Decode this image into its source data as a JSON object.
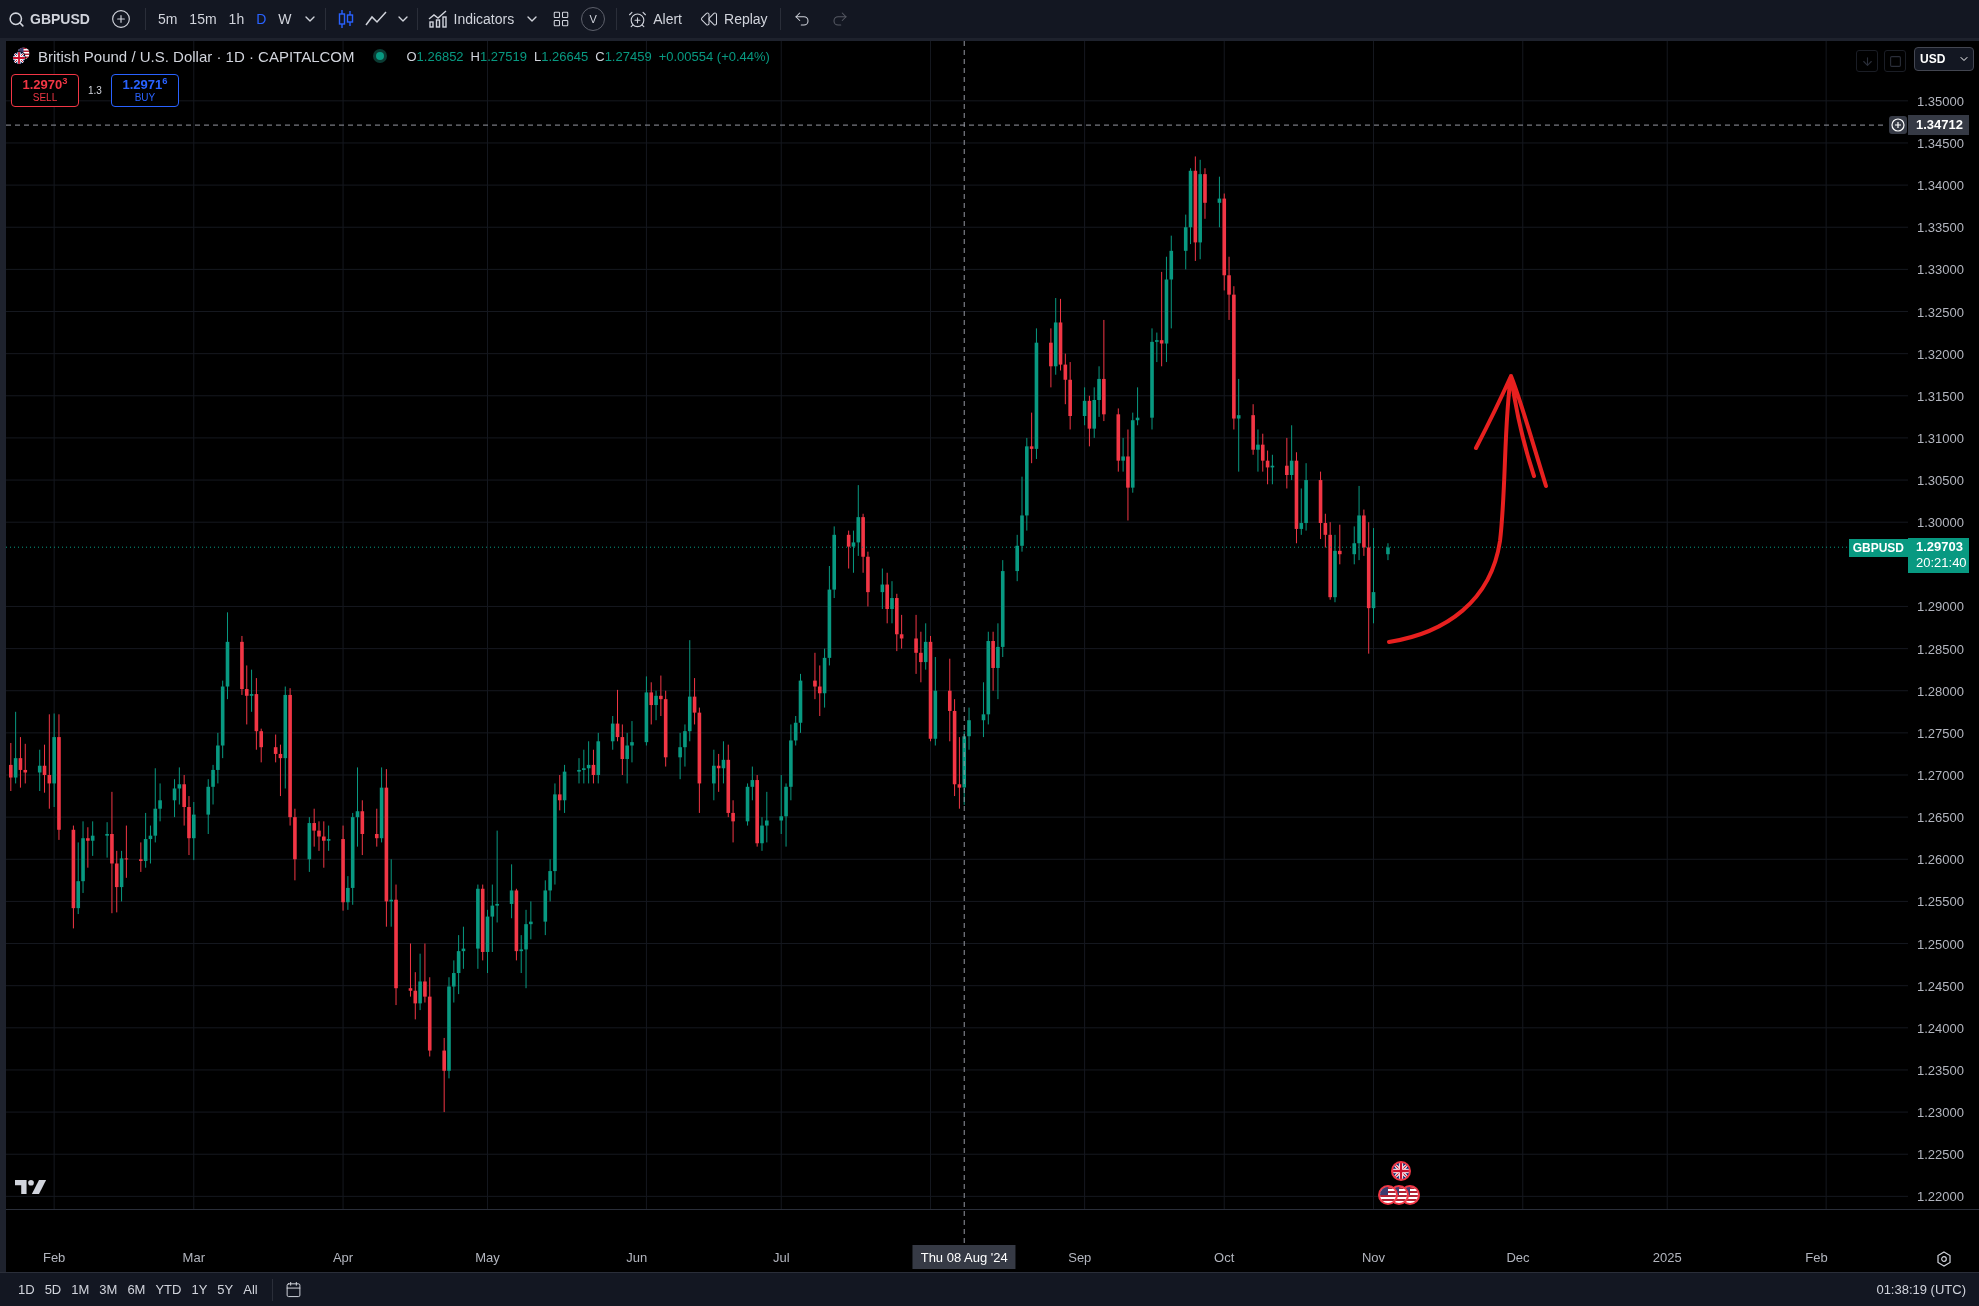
{
  "toolbar": {
    "symbol": "GBPUSD",
    "intervals": [
      {
        "label": "5m",
        "selected": false
      },
      {
        "label": "15m",
        "selected": false
      },
      {
        "label": "1h",
        "selected": false
      },
      {
        "label": "D",
        "selected": true
      },
      {
        "label": "W",
        "selected": false
      }
    ],
    "chart_styles": [
      {
        "kind": "candles",
        "selected": true
      },
      {
        "kind": "line",
        "selected": false
      }
    ],
    "indicators": "Indicators",
    "v_button": "V",
    "alert": "Alert",
    "replay": "Replay",
    "undo_disabled": false,
    "redo_disabled": true
  },
  "legend": {
    "title": "British Pound / U.S. Dollar · 1D · CAPITALCOM",
    "market_open": true,
    "change_up": true,
    "readings": [
      {
        "key": "O",
        "value": "1.26852"
      },
      {
        "key": "H",
        "value": "1.27519"
      },
      {
        "key": "L",
        "value": "1.26645"
      },
      {
        "key": "C",
        "value": "1.27459"
      }
    ],
    "change": "+0.00554 (+0.44%)"
  },
  "trade": {
    "sell_price": "1.2970$^{3}$",
    "sell_label": "SELL",
    "spread": "1.3",
    "buy_price": "1.2971$^{6}$",
    "buy_label": "BUY"
  },
  "price_scale": {
    "currency": "USD"
  },
  "price_tag": {
    "symbol": "GBPUSD",
    "countdown": "20:21:40"
  },
  "chart": {
    "chart_data": {
      "type": "candlestick",
      "grid": true,
      "xlim": [
        "2024-01-22",
        "2025-02-20"
      ],
      "ylim": [
        1.2185,
        1.3571
      ],
      "x": [
        "2024-01-23",
        "2024-01-24",
        "2024-01-25",
        "2024-01-26",
        "2024-01-29",
        "2024-01-30",
        "2024-01-31",
        "2024-02-01",
        "2024-02-02",
        "2024-02-05",
        "2024-02-06",
        "2024-02-07",
        "2024-02-08",
        "2024-02-09",
        "2024-02-12",
        "2024-02-13",
        "2024-02-14",
        "2024-02-15",
        "2024-02-16",
        "2024-02-19",
        "2024-02-20",
        "2024-02-21",
        "2024-02-22",
        "2024-02-23",
        "2024-02-26",
        "2024-02-27",
        "2024-02-28",
        "2024-02-29",
        "2024-03-01",
        "2024-03-04",
        "2024-03-05",
        "2024-03-06",
        "2024-03-07",
        "2024-03-08",
        "2024-03-11",
        "2024-03-12",
        "2024-03-13",
        "2024-03-14",
        "2024-03-15",
        "2024-03-18",
        "2024-03-19",
        "2024-03-20",
        "2024-03-21",
        "2024-03-22",
        "2024-03-25",
        "2024-03-26",
        "2024-03-27",
        "2024-03-28",
        "2024-03-29",
        "2024-04-01",
        "2024-04-02",
        "2024-04-03",
        "2024-04-04",
        "2024-04-05",
        "2024-04-08",
        "2024-04-09",
        "2024-04-10",
        "2024-04-11",
        "2024-04-12",
        "2024-04-15",
        "2024-04-16",
        "2024-04-17",
        "2024-04-18",
        "2024-04-19",
        "2024-04-22",
        "2024-04-23",
        "2024-04-24",
        "2024-04-25",
        "2024-04-26",
        "2024-04-29",
        "2024-04-30",
        "2024-05-01",
        "2024-05-02",
        "2024-05-03",
        "2024-05-06",
        "2024-05-07",
        "2024-05-08",
        "2024-05-09",
        "2024-05-10",
        "2024-05-13",
        "2024-05-14",
        "2024-05-15",
        "2024-05-16",
        "2024-05-17",
        "2024-05-20",
        "2024-05-21",
        "2024-05-22",
        "2024-05-23",
        "2024-05-24",
        "2024-05-27",
        "2024-05-28",
        "2024-05-29",
        "2024-05-30",
        "2024-05-31",
        "2024-06-03",
        "2024-06-04",
        "2024-06-05",
        "2024-06-06",
        "2024-06-07",
        "2024-06-10",
        "2024-06-11",
        "2024-06-12",
        "2024-06-13",
        "2024-06-14",
        "2024-06-17",
        "2024-06-18",
        "2024-06-19",
        "2024-06-20",
        "2024-06-21",
        "2024-06-24",
        "2024-06-25",
        "2024-06-26",
        "2024-06-27",
        "2024-06-28",
        "2024-07-01",
        "2024-07-02",
        "2024-07-03",
        "2024-07-04",
        "2024-07-05",
        "2024-07-08",
        "2024-07-09",
        "2024-07-10",
        "2024-07-11",
        "2024-07-12",
        "2024-07-15",
        "2024-07-16",
        "2024-07-17",
        "2024-07-18",
        "2024-07-19",
        "2024-07-22",
        "2024-07-23",
        "2024-07-24",
        "2024-07-25",
        "2024-07-26",
        "2024-07-29",
        "2024-07-30",
        "2024-07-31",
        "2024-08-01",
        "2024-08-02",
        "2024-08-05",
        "2024-08-06",
        "2024-08-07",
        "2024-08-08",
        "2024-08-09",
        "2024-08-12",
        "2024-08-13",
        "2024-08-14",
        "2024-08-15",
        "2024-08-16",
        "2024-08-19",
        "2024-08-20",
        "2024-08-21",
        "2024-08-22",
        "2024-08-23",
        "2024-08-26",
        "2024-08-27",
        "2024-08-28",
        "2024-08-29",
        "2024-08-30",
        "2024-09-02",
        "2024-09-03",
        "2024-09-04",
        "2024-09-05",
        "2024-09-06",
        "2024-09-09",
        "2024-09-10",
        "2024-09-11",
        "2024-09-12",
        "2024-09-13",
        "2024-09-16",
        "2024-09-17",
        "2024-09-18",
        "2024-09-19",
        "2024-09-20",
        "2024-09-23",
        "2024-09-24",
        "2024-09-25",
        "2024-09-26",
        "2024-09-27",
        "2024-09-30",
        "2024-10-01",
        "2024-10-02",
        "2024-10-03",
        "2024-10-04",
        "2024-10-07",
        "2024-10-08",
        "2024-10-09",
        "2024-10-10",
        "2024-10-11",
        "2024-10-14",
        "2024-10-15",
        "2024-10-16",
        "2024-10-17",
        "2024-10-18",
        "2024-10-21",
        "2024-10-22",
        "2024-10-23",
        "2024-10-24",
        "2024-10-25",
        "2024-10-28",
        "2024-10-29",
        "2024-10-30",
        "2024-10-31",
        "2024-11-01",
        "2024-11-04"
      ],
      "ohlc": [
        [
          1.2712,
          1.2738,
          1.2681,
          1.2697
        ],
        [
          1.2697,
          1.2775,
          1.269,
          1.272
        ],
        [
          1.272,
          1.2745,
          1.2685,
          1.2706
        ],
        [
          1.2706,
          1.2737,
          1.269,
          1.2703
        ],
        [
          1.2703,
          1.273,
          1.2681,
          1.2711
        ],
        [
          1.2711,
          1.2736,
          1.2679,
          1.27
        ],
        [
          1.27,
          1.2772,
          1.266,
          1.269
        ],
        [
          1.269,
          1.2773,
          1.2662,
          1.2745
        ],
        [
          1.2745,
          1.2772,
          1.2623,
          1.2635
        ],
        [
          1.2635,
          1.264,
          1.2518,
          1.2542
        ],
        [
          1.2542,
          1.262,
          1.2535,
          1.2574
        ],
        [
          1.2574,
          1.2645,
          1.256,
          1.2625
        ],
        [
          1.2625,
          1.2638,
          1.259,
          1.2622
        ],
        [
          1.2622,
          1.2645,
          1.2604,
          1.2628
        ],
        [
          1.2628,
          1.2644,
          1.2602,
          1.263
        ],
        [
          1.263,
          1.268,
          1.2536,
          1.2595
        ],
        [
          1.2595,
          1.261,
          1.2537,
          1.2567
        ],
        [
          1.2567,
          1.261,
          1.255,
          1.2601
        ],
        [
          1.2601,
          1.264,
          1.2578,
          1.26
        ],
        [
          1.26,
          1.262,
          1.2585,
          1.2598
        ],
        [
          1.2598,
          1.2655,
          1.259,
          1.2624
        ],
        [
          1.2624,
          1.264,
          1.2595,
          1.2628
        ],
        [
          1.2628,
          1.2708,
          1.262,
          1.266
        ],
        [
          1.266,
          1.269,
          1.2645,
          1.267
        ],
        [
          1.267,
          1.2695,
          1.265,
          1.2684
        ],
        [
          1.2684,
          1.2709,
          1.2665,
          1.2689
        ],
        [
          1.2689,
          1.27,
          1.264,
          1.2662
        ],
        [
          1.2662,
          1.2675,
          1.2605,
          1.2625
        ],
        [
          1.2625,
          1.2668,
          1.2599,
          1.2653
        ],
        [
          1.2653,
          1.2695,
          1.263,
          1.2686
        ],
        [
          1.2686,
          1.2712,
          1.2665,
          1.2706
        ],
        [
          1.2706,
          1.275,
          1.269,
          1.2735
        ],
        [
          1.2735,
          1.2812,
          1.272,
          1.2805
        ],
        [
          1.2805,
          1.2893,
          1.279,
          1.2858
        ],
        [
          1.2858,
          1.2865,
          1.2795,
          1.2802
        ],
        [
          1.2802,
          1.283,
          1.276,
          1.2794
        ],
        [
          1.2794,
          1.2825,
          1.2775,
          1.2796
        ],
        [
          1.2796,
          1.2815,
          1.273,
          1.2752
        ],
        [
          1.2752,
          1.2755,
          1.2715,
          1.2733
        ],
        [
          1.2733,
          1.2748,
          1.2715,
          1.2725
        ],
        [
          1.2725,
          1.2736,
          1.2675,
          1.272
        ],
        [
          1.272,
          1.2805,
          1.2684,
          1.2795
        ],
        [
          1.2795,
          1.2803,
          1.264,
          1.265
        ],
        [
          1.265,
          1.266,
          1.2575,
          1.26
        ],
        [
          1.26,
          1.265,
          1.2585,
          1.2643
        ],
        [
          1.2643,
          1.266,
          1.2615,
          1.2634
        ],
        [
          1.2634,
          1.2645,
          1.261,
          1.2627
        ],
        [
          1.2627,
          1.2645,
          1.259,
          1.2622
        ],
        [
          1.2622,
          1.264,
          1.261,
          1.2624
        ],
        [
          1.2624,
          1.264,
          1.2539,
          1.2549
        ],
        [
          1.2549,
          1.258,
          1.254,
          1.2566
        ],
        [
          1.2566,
          1.2655,
          1.2546,
          1.265
        ],
        [
          1.265,
          1.2709,
          1.2615,
          1.2657
        ],
        [
          1.2657,
          1.267,
          1.2605,
          1.263
        ],
        [
          1.263,
          1.266,
          1.2615,
          1.2625
        ],
        [
          1.2625,
          1.2709,
          1.262,
          1.2685
        ],
        [
          1.2685,
          1.2707,
          1.252,
          1.255
        ],
        [
          1.255,
          1.26,
          1.252,
          1.2552
        ],
        [
          1.2552,
          1.257,
          1.2427,
          1.2447
        ],
        [
          1.2447,
          1.25,
          1.2437,
          1.2444
        ],
        [
          1.2444,
          1.2466,
          1.241,
          1.2429
        ],
        [
          1.2429,
          1.2488,
          1.2421,
          1.2455
        ],
        [
          1.2455,
          1.25,
          1.243,
          1.2437
        ],
        [
          1.2437,
          1.246,
          1.2366,
          1.2373
        ],
        [
          1.2373,
          1.2388,
          1.23,
          1.2349
        ],
        [
          1.2349,
          1.246,
          1.234,
          1.2449
        ],
        [
          1.2449,
          1.248,
          1.243,
          1.2465
        ],
        [
          1.2465,
          1.251,
          1.244,
          1.2491
        ],
        [
          1.2491,
          1.252,
          1.247,
          1.2494
        ],
        [
          1.2494,
          1.257,
          1.247,
          1.2565
        ],
        [
          1.2565,
          1.257,
          1.248,
          1.249
        ],
        [
          1.249,
          1.254,
          1.2465,
          1.2532
        ],
        [
          1.2532,
          1.257,
          1.249,
          1.2545
        ],
        [
          1.2545,
          1.2634,
          1.2525,
          1.2547
        ],
        [
          1.2547,
          1.2594,
          1.253,
          1.2563
        ],
        [
          1.2563,
          1.2565,
          1.248,
          1.2491
        ],
        [
          1.2491,
          1.251,
          1.2465,
          1.2493
        ],
        [
          1.2493,
          1.254,
          1.2447,
          1.2523
        ],
        [
          1.2523,
          1.255,
          1.2505,
          1.2526
        ],
        [
          1.2526,
          1.2575,
          1.251,
          1.2563
        ],
        [
          1.2563,
          1.26,
          1.255,
          1.2586
        ],
        [
          1.2586,
          1.269,
          1.257,
          1.2677
        ],
        [
          1.2677,
          1.27,
          1.2658,
          1.267
        ],
        [
          1.267,
          1.2712,
          1.2655,
          1.2704
        ],
        [
          1.2704,
          1.272,
          1.269,
          1.2706
        ],
        [
          1.2706,
          1.273,
          1.269,
          1.2708
        ],
        [
          1.2708,
          1.274,
          1.269,
          1.2712
        ],
        [
          1.2712,
          1.273,
          1.269,
          1.27
        ],
        [
          1.27,
          1.275,
          1.269,
          1.274
        ],
        [
          1.274,
          1.277,
          1.273,
          1.2761
        ],
        [
          1.2761,
          1.2801,
          1.274,
          1.2745
        ],
        [
          1.2745,
          1.276,
          1.27,
          1.2719
        ],
        [
          1.2719,
          1.275,
          1.269,
          1.2735
        ],
        [
          1.2735,
          1.2764,
          1.2715,
          1.2739
        ],
        [
          1.2739,
          1.2817,
          1.2735,
          1.2798
        ],
        [
          1.2798,
          1.281,
          1.276,
          1.2783
        ],
        [
          1.2783,
          1.28,
          1.2765,
          1.2794
        ],
        [
          1.2794,
          1.2818,
          1.277,
          1.279
        ],
        [
          1.279,
          1.28,
          1.271,
          1.2721
        ],
        [
          1.2721,
          1.275,
          1.2695,
          1.2733
        ],
        [
          1.2733,
          1.276,
          1.271,
          1.2752
        ],
        [
          1.2752,
          1.286,
          1.274,
          1.2793
        ],
        [
          1.2793,
          1.2815,
          1.276,
          1.2774
        ],
        [
          1.2774,
          1.278,
          1.2655,
          1.269
        ],
        [
          1.269,
          1.273,
          1.267,
          1.2711
        ],
        [
          1.2711,
          1.2725,
          1.268,
          1.2708
        ],
        [
          1.2708,
          1.274,
          1.269,
          1.2718
        ],
        [
          1.2718,
          1.2736,
          1.265,
          1.2655
        ],
        [
          1.2655,
          1.267,
          1.262,
          1.2645
        ],
        [
          1.2645,
          1.269,
          1.264,
          1.2686
        ],
        [
          1.2686,
          1.271,
          1.267,
          1.2694
        ],
        [
          1.2694,
          1.27,
          1.2615,
          1.2619
        ],
        [
          1.2619,
          1.265,
          1.261,
          1.264
        ],
        [
          1.264,
          1.268,
          1.262,
          1.2646
        ],
        [
          1.2646,
          1.27,
          1.263,
          1.2651
        ],
        [
          1.2651,
          1.269,
          1.2615,
          1.2686
        ],
        [
          1.2686,
          1.276,
          1.267,
          1.2741
        ],
        [
          1.2741,
          1.277,
          1.2735,
          1.2762
        ],
        [
          1.2762,
          1.282,
          1.275,
          1.2812
        ],
        [
          1.2812,
          1.2845,
          1.279,
          1.2805
        ],
        [
          1.2805,
          1.283,
          1.277,
          1.2797
        ],
        [
          1.2797,
          1.285,
          1.278,
          1.2839
        ],
        [
          1.2839,
          1.2948,
          1.283,
          1.292
        ],
        [
          1.292,
          1.2995,
          1.291,
          1.2985
        ],
        [
          1.2985,
          1.299,
          1.2945,
          1.2971
        ],
        [
          1.2971,
          1.299,
          1.294,
          1.2976
        ],
        [
          1.2976,
          1.3044,
          1.296,
          1.3006
        ],
        [
          1.3006,
          1.301,
          1.294,
          1.2959
        ],
        [
          1.2959,
          1.2965,
          1.29,
          1.2917
        ],
        [
          1.2917,
          1.2945,
          1.2897,
          1.2926
        ],
        [
          1.2926,
          1.294,
          1.288,
          1.2897
        ],
        [
          1.2897,
          1.293,
          1.288,
          1.291
        ],
        [
          1.291,
          1.2915,
          1.2847,
          1.2867
        ],
        [
          1.2867,
          1.289,
          1.285,
          1.2862
        ],
        [
          1.2862,
          1.289,
          1.282,
          1.2845
        ],
        [
          1.2845,
          1.287,
          1.281,
          1.2834
        ],
        [
          1.2834,
          1.288,
          1.2825,
          1.2858
        ],
        [
          1.2858,
          1.2865,
          1.274,
          1.2743
        ],
        [
          1.2743,
          1.284,
          1.2735,
          1.28
        ],
        [
          1.28,
          1.2838,
          1.274,
          1.2776
        ],
        [
          1.2776,
          1.279,
          1.2675,
          1.2689
        ],
        [
          1.2689,
          1.2745,
          1.266,
          1.2685
        ],
        [
          1.26852,
          1.27519,
          1.26645,
          1.27459
        ],
        [
          1.2746,
          1.278,
          1.273,
          1.2765
        ],
        [
          1.2765,
          1.281,
          1.2745,
          1.2772
        ],
        [
          1.2772,
          1.287,
          1.276,
          1.2859
        ],
        [
          1.2859,
          1.287,
          1.28,
          1.2827
        ],
        [
          1.2827,
          1.288,
          1.279,
          1.2852
        ],
        [
          1.2852,
          1.2955,
          1.284,
          1.2942
        ],
        [
          1.2942,
          1.2985,
          1.293,
          1.2972
        ],
        [
          1.2972,
          1.3054,
          1.2965,
          1.3008
        ],
        [
          1.3008,
          1.31,
          1.299,
          1.309
        ],
        [
          1.309,
          1.313,
          1.307,
          1.3087
        ],
        [
          1.3087,
          1.323,
          1.3075,
          1.3213
        ],
        [
          1.3213,
          1.323,
          1.316,
          1.3185
        ],
        [
          1.3185,
          1.3266,
          1.3175,
          1.3237
        ],
        [
          1.3237,
          1.3265,
          1.318,
          1.3187
        ],
        [
          1.3187,
          1.32,
          1.314,
          1.3169
        ],
        [
          1.3169,
          1.319,
          1.311,
          1.3126
        ],
        [
          1.3126,
          1.316,
          1.3115,
          1.3144
        ],
        [
          1.3144,
          1.315,
          1.309,
          1.3111
        ],
        [
          1.3111,
          1.316,
          1.31,
          1.3145
        ],
        [
          1.3145,
          1.3185,
          1.3125,
          1.317
        ],
        [
          1.317,
          1.324,
          1.312,
          1.3128
        ],
        [
          1.3128,
          1.3135,
          1.306,
          1.3073
        ],
        [
          1.3073,
          1.31,
          1.306,
          1.3078
        ],
        [
          1.3078,
          1.311,
          1.3002,
          1.3041
        ],
        [
          1.3041,
          1.313,
          1.3035,
          1.3121
        ],
        [
          1.3121,
          1.316,
          1.3115,
          1.3124
        ],
        [
          1.3124,
          1.323,
          1.311,
          1.3214
        ],
        [
          1.3214,
          1.3225,
          1.319,
          1.3216
        ],
        [
          1.3216,
          1.3297,
          1.3185,
          1.3212
        ],
        [
          1.3212,
          1.3315,
          1.319,
          1.3288
        ],
        [
          1.3288,
          1.334,
          1.323,
          1.3322
        ],
        [
          1.3322,
          1.3365,
          1.33,
          1.335
        ],
        [
          1.335,
          1.342,
          1.333,
          1.3417
        ],
        [
          1.3417,
          1.3434,
          1.331,
          1.3332
        ],
        [
          1.3332,
          1.343,
          1.3312,
          1.3413
        ],
        [
          1.3413,
          1.342,
          1.336,
          1.3379
        ],
        [
          1.3379,
          1.341,
          1.335,
          1.3384
        ],
        [
          1.3384,
          1.339,
          1.3275,
          1.3293
        ],
        [
          1.3293,
          1.3315,
          1.324,
          1.327
        ],
        [
          1.327,
          1.328,
          1.311,
          1.3123
        ],
        [
          1.3123,
          1.317,
          1.306,
          1.3127
        ],
        [
          1.3127,
          1.314,
          1.308,
          1.3086
        ],
        [
          1.3086,
          1.311,
          1.306,
          1.3092
        ],
        [
          1.3092,
          1.3105,
          1.306,
          1.3073
        ],
        [
          1.3073,
          1.3085,
          1.3045,
          1.3065
        ],
        [
          1.3065,
          1.308,
          1.3045,
          1.3067
        ],
        [
          1.3067,
          1.31,
          1.304,
          1.3056
        ],
        [
          1.3056,
          1.3115,
          1.305,
          1.3073
        ],
        [
          1.3073,
          1.3083,
          1.2975,
          1.2992
        ],
        [
          1.2992,
          1.304,
          1.2985,
          1.2999
        ],
        [
          1.2999,
          1.307,
          1.299,
          1.305
        ],
        [
          1.305,
          1.306,
          1.298,
          1.2999
        ],
        [
          1.2999,
          1.301,
          1.297,
          1.2985
        ],
        [
          1.2985,
          1.3,
          1.2908,
          1.2911
        ],
        [
          1.2911,
          1.2985,
          1.2905,
          1.2966
        ],
        [
          1.2966,
          1.2997,
          1.295,
          1.2962
        ],
        [
          1.2962,
          1.2995,
          1.295,
          1.2975
        ],
        [
          1.2975,
          1.3043,
          1.2955,
          1.3008
        ],
        [
          1.3008,
          1.3015,
          1.296,
          1.297
        ],
        [
          1.297,
          1.3,
          1.2844,
          1.2898
        ],
        [
          1.2898,
          1.2993,
          1.288,
          1.2917
        ],
        [
          1.2962,
          1.2975,
          1.2955,
          1.297
        ]
      ],
      "yticks": [
        {
          "value": 1.22,
          "label": "1.22000"
        },
        {
          "value": 1.225,
          "label": "1.22500"
        },
        {
          "value": 1.23,
          "label": "1.23000"
        },
        {
          "value": 1.235,
          "label": "1.23500"
        },
        {
          "value": 1.24,
          "label": "1.24000"
        },
        {
          "value": 1.245,
          "label": "1.24500"
        },
        {
          "value": 1.25,
          "label": "1.25000"
        },
        {
          "value": 1.255,
          "label": "1.25500"
        },
        {
          "value": 1.26,
          "label": "1.26000"
        },
        {
          "value": 1.265,
          "label": "1.26500"
        },
        {
          "value": 1.27,
          "label": "1.27000"
        },
        {
          "value": 1.275,
          "label": "1.27500"
        },
        {
          "value": 1.28,
          "label": "1.28000"
        },
        {
          "value": 1.285,
          "label": "1.28500"
        },
        {
          "value": 1.29,
          "label": "1.29000"
        },
        {
          "value": 1.3,
          "label": "1.30000"
        },
        {
          "value": 1.305,
          "label": "1.30500"
        },
        {
          "value": 1.31,
          "label": "1.31000"
        },
        {
          "value": 1.315,
          "label": "1.31500"
        },
        {
          "value": 1.32,
          "label": "1.32000"
        },
        {
          "value": 1.325,
          "label": "1.32500"
        },
        {
          "value": 1.33,
          "label": "1.33000"
        },
        {
          "value": 1.335,
          "label": "1.33500"
        },
        {
          "value": 1.34,
          "label": "1.34000"
        },
        {
          "value": 1.345,
          "label": "1.34500"
        },
        {
          "value": 1.35,
          "label": "1.35000"
        }
      ],
      "xticks": [
        {
          "value": "2024-02-01",
          "label": "Feb"
        },
        {
          "value": "2024-03-01",
          "label": "Mar"
        },
        {
          "value": "2024-04-01",
          "label": "Apr"
        },
        {
          "value": "2024-05-01",
          "label": "May"
        },
        {
          "value": "2024-06-01",
          "label": "Jun"
        },
        {
          "value": "2024-07-01",
          "label": "Jul"
        },
        {
          "value": "2024-09-01",
          "label": "Sep"
        },
        {
          "value": "2024-10-01",
          "label": "Oct"
        },
        {
          "value": "2024-11-01",
          "label": "Nov"
        },
        {
          "value": "2024-12-01",
          "label": "Dec"
        },
        {
          "value": "2025-01-01",
          "label": "2025"
        },
        {
          "value": "2025-02-01",
          "label": "Feb"
        }
      ],
      "ref_lines": [
        {
          "axis": "x",
          "value": "2024-08-08",
          "label": "Thu 08 Aug '24",
          "color": "#9598a1",
          "line_style": "dashed"
        },
        {
          "axis": "y",
          "value": 1.34712,
          "label": "1.34712",
          "color": "#9598a1",
          "line_style": "dashed"
        },
        {
          "axis": "y",
          "value": 1.29703,
          "label": "1.29703",
          "color": "#089981",
          "line_style": "dotted"
        }
      ]
    }
  },
  "bottom_bar": {
    "ranges": [
      {
        "label": "1D",
        "selected": false
      },
      {
        "label": "5D",
        "selected": false
      },
      {
        "label": "1M",
        "selected": false
      },
      {
        "label": "3M",
        "selected": false
      },
      {
        "label": "6M",
        "selected": false
      },
      {
        "label": "YTD",
        "selected": false
      },
      {
        "label": "1Y",
        "selected": false
      },
      {
        "label": "5Y",
        "selected": false
      },
      {
        "label": "All",
        "selected": false
      }
    ],
    "clock": "01:38:19 (UTC)"
  }
}
